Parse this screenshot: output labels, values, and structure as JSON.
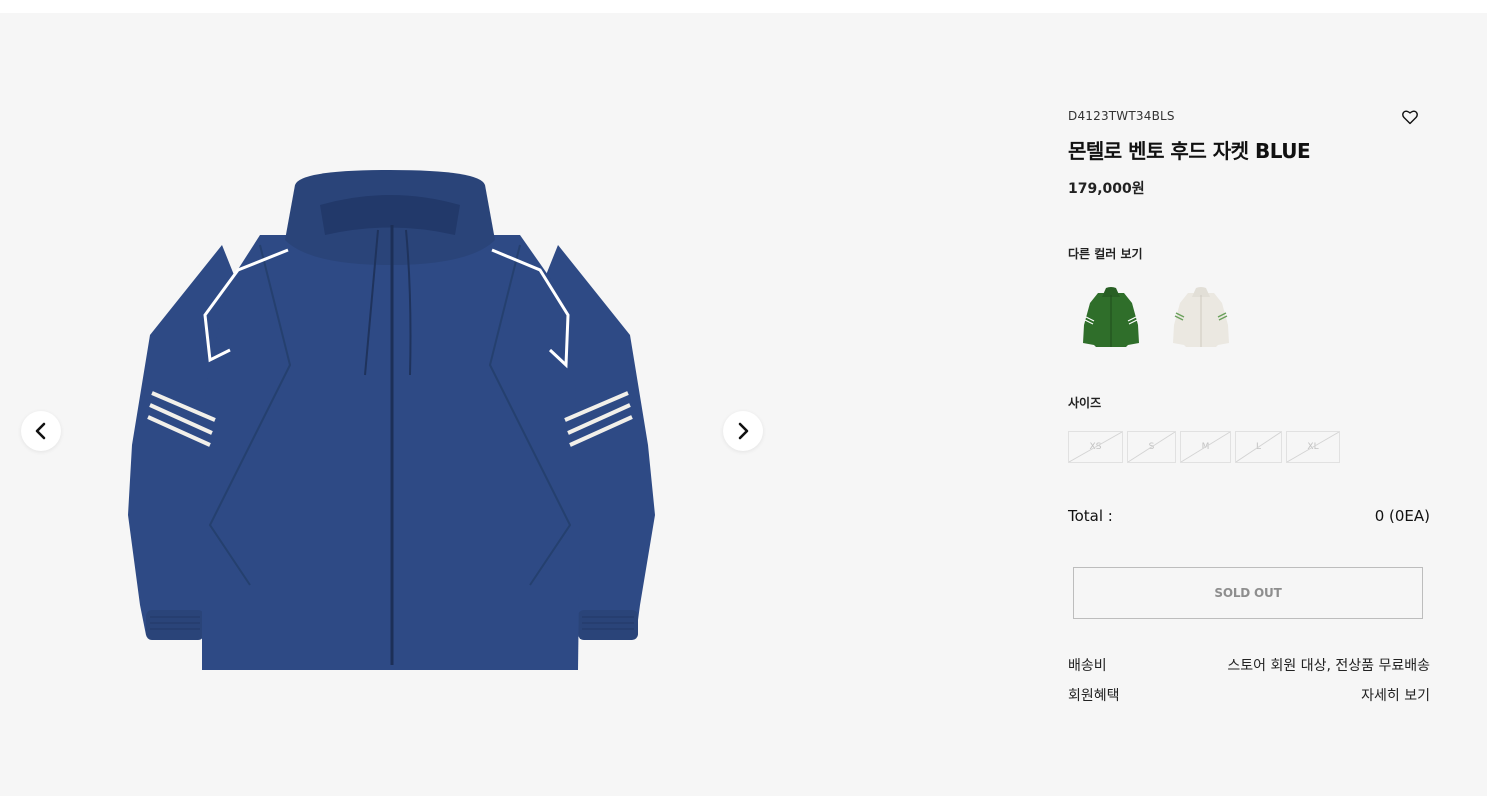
{
  "product": {
    "sku": "D4123TWT34BLS",
    "title": "몬텔로 벤토 후드 자켓 BLUE",
    "price": "179,000원",
    "main_color": "#2e4a85",
    "stripe_color": "#ffffff"
  },
  "colors": {
    "label": "다른 컬러 보기",
    "options": [
      {
        "name": "green",
        "hex": "#2f6e2a"
      },
      {
        "name": "ivory",
        "hex": "#ebe8e1"
      }
    ]
  },
  "sizes": {
    "label": "사이즈",
    "options": [
      {
        "label": "XS",
        "available": false
      },
      {
        "label": "S",
        "available": false
      },
      {
        "label": "M",
        "available": false
      },
      {
        "label": "L",
        "available": false
      },
      {
        "label": "XL",
        "available": false
      }
    ]
  },
  "total": {
    "label": "Total :",
    "value": "0 (0EA)"
  },
  "cta": {
    "label": "SOLD OUT"
  },
  "info_rows": [
    {
      "label": "배송비",
      "value": "스토어 회원 대상, 전상품 무료배송"
    },
    {
      "label": "회원혜택",
      "value": "자세히 보기"
    }
  ],
  "icons": {
    "prev": "chevron-left-icon",
    "next": "chevron-right-icon",
    "wishlist": "heart-icon"
  }
}
